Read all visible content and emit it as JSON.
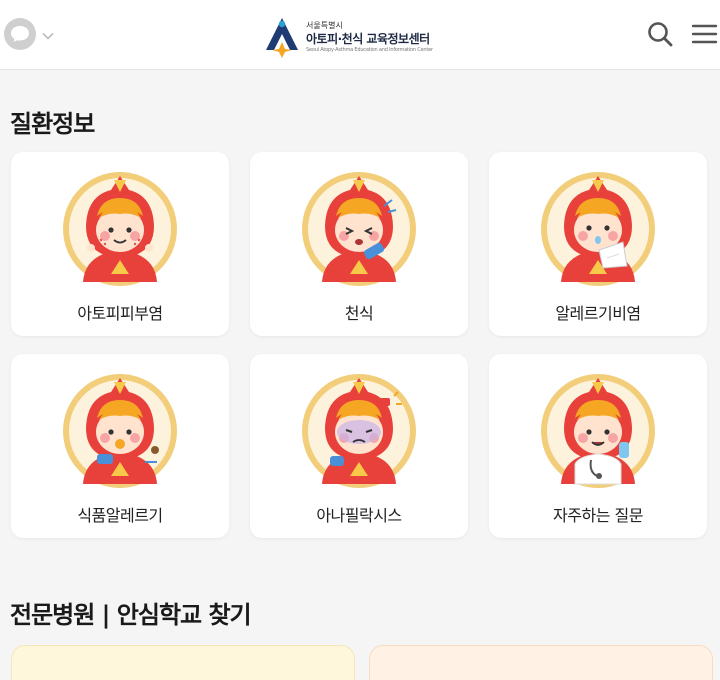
{
  "header": {
    "logo": {
      "city": "서울특별시",
      "name": "아토피·천식 교육정보센터",
      "subtitle": "Seoul Atopy·Asthma Education and Information Center"
    },
    "icons": {
      "chat": "chat-bubble-icon",
      "dropdown": "chevron-down-icon",
      "search": "search-icon",
      "menu": "hamburger-menu-icon"
    }
  },
  "disease_info": {
    "title": "질환정보",
    "items": [
      {
        "label": "아토피피부염",
        "icon": "atopic-dermatitis-character"
      },
      {
        "label": "천식",
        "icon": "asthma-character"
      },
      {
        "label": "알레르기비염",
        "icon": "allergic-rhinitis-character"
      },
      {
        "label": "식품알레르기",
        "icon": "food-allergy-character"
      },
      {
        "label": "아나필락시스",
        "icon": "anaphylaxis-character"
      },
      {
        "label": "자주하는 질문",
        "icon": "faq-doctor-character"
      }
    ]
  },
  "hospital_school": {
    "title": "전문병원 | 안심학교 찾기"
  },
  "colors": {
    "background": "#f5f5f5",
    "card": "#ffffff",
    "character_red": "#e8403a",
    "ring_yellow": "#f2cd7a",
    "hospital_card": "#fff7dc",
    "school_card": "#fff1e3"
  }
}
